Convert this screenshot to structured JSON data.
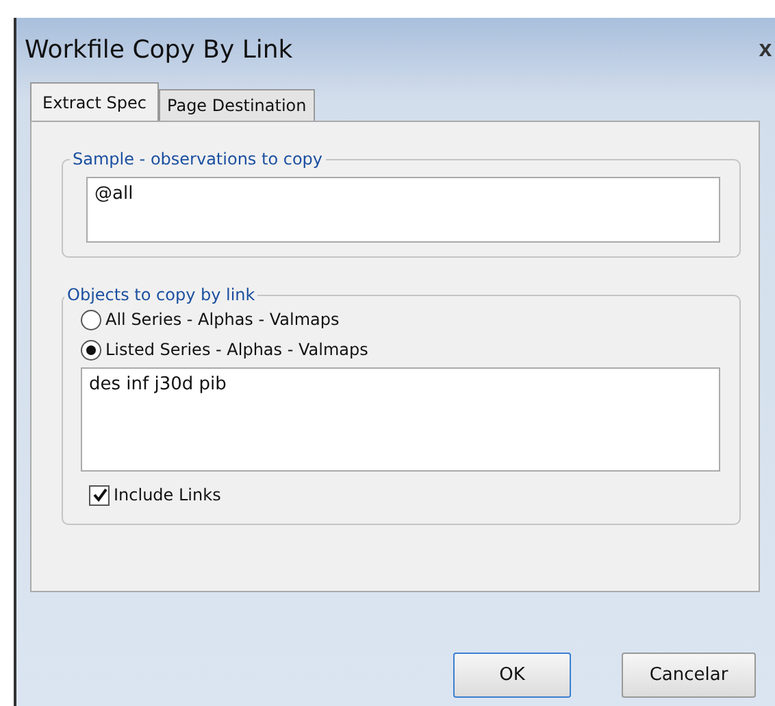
{
  "window": {
    "title": "Workfile Copy By Link",
    "close": "x"
  },
  "tabs": [
    {
      "label": "Extract Spec",
      "selected": true
    },
    {
      "label": "Page Destination",
      "selected": false
    }
  ],
  "sample": {
    "legend": "Sample - observations to copy",
    "value": "@all"
  },
  "objects": {
    "legend": "Objects to copy by link",
    "options": [
      {
        "label": "All Series - Alphas - Valmaps",
        "selected": false
      },
      {
        "label": "Listed Series -  Alphas - Valmaps",
        "selected": true
      }
    ],
    "list_value": "des inf j30d pib",
    "include_links": {
      "label": "Include Links",
      "checked": true
    }
  },
  "buttons": [
    {
      "label": "OK",
      "default": true
    },
    {
      "label": "Cancelar",
      "default": false
    }
  ]
}
